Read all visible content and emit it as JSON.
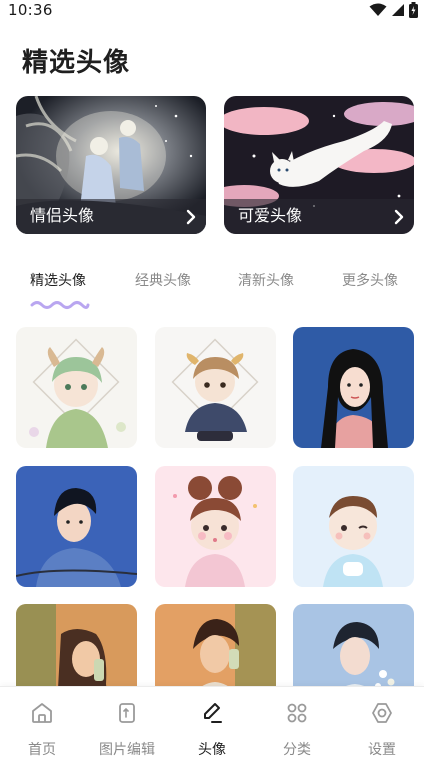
{
  "status_bar": {
    "time": "10:36"
  },
  "page_title": "精选头像",
  "featured": [
    {
      "label": "情侣头像"
    },
    {
      "label": "可爱头像"
    }
  ],
  "tabs": [
    {
      "label": "精选头像",
      "active": true
    },
    {
      "label": "经典头像",
      "active": false
    },
    {
      "label": "清新头像",
      "active": false
    },
    {
      "label": "更多头像",
      "active": false
    }
  ],
  "accent_color": "#b9a6f0",
  "grid": [
    {
      "subject": "green-haired horned character illustration"
    },
    {
      "subject": "brown-haired chibi with dog ears"
    },
    {
      "subject": "black-haired girl on blue background"
    },
    {
      "subject": "boy in blue hoodie on bicycle"
    },
    {
      "subject": "chibi girl with hair buns on pink"
    },
    {
      "subject": "winking boy on light blue"
    },
    {
      "subject": "girl drinking in warm light"
    },
    {
      "subject": "boy drinking in warm light"
    },
    {
      "subject": "boy with flowers on blue"
    }
  ],
  "bottom_nav": [
    {
      "label": "首页",
      "icon": "home-icon",
      "active": false
    },
    {
      "label": "图片编辑",
      "icon": "image-edit-icon",
      "active": false
    },
    {
      "label": "头像",
      "icon": "pen-icon",
      "active": true
    },
    {
      "label": "分类",
      "icon": "grid-icon",
      "active": false
    },
    {
      "label": "设置",
      "icon": "settings-icon",
      "active": false
    }
  ]
}
